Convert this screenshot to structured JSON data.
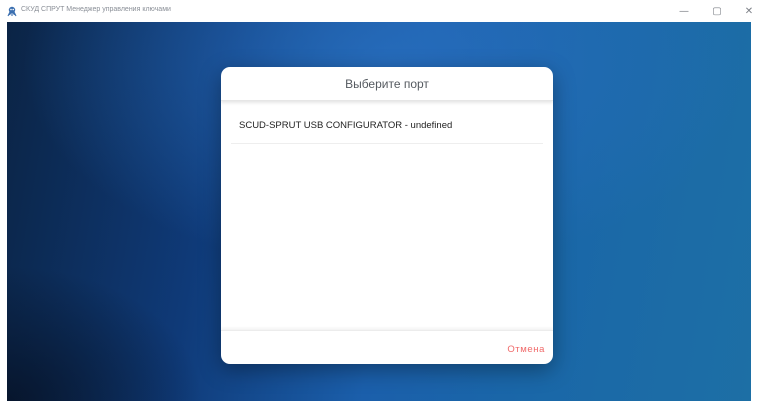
{
  "window": {
    "title": "СКУД СПРУТ Менеджер управления ключами",
    "icon": "app-logo-icon",
    "controls": {
      "minimize": "—",
      "maximize": "▢",
      "close": "✕"
    }
  },
  "dialog": {
    "title": "Выберите порт",
    "ports": [
      {
        "label": "SCUD-SPRUT USB CONFIGURATOR - undefined"
      }
    ],
    "cancel_label": "Отмена"
  },
  "colors": {
    "background_dark": "#0b2445",
    "background_mid": "#1b5fab",
    "cancel_accent": "#f06a6a",
    "dialog_bg": "#ffffff"
  }
}
